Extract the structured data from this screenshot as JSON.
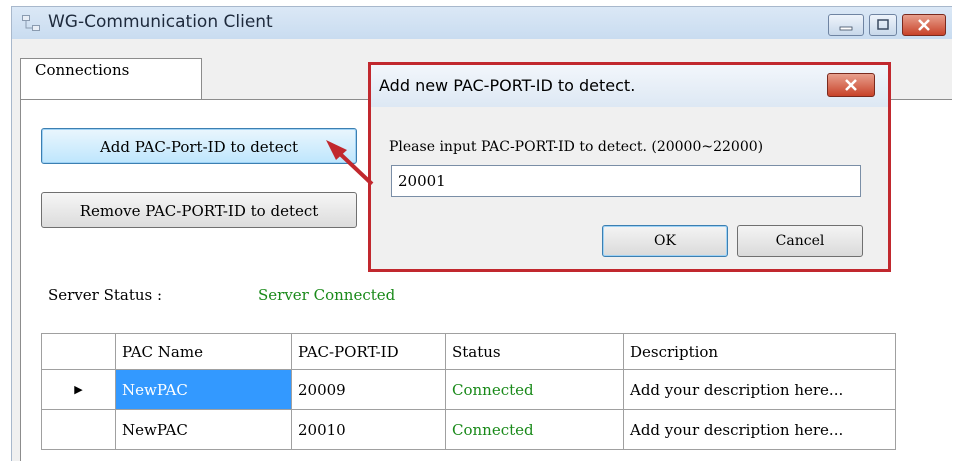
{
  "window": {
    "title": "WG-Communication Client",
    "icon": "network-computers-icon"
  },
  "tabs": [
    {
      "label": "Connections",
      "selected": true
    }
  ],
  "buttons": {
    "add_label": "Add PAC-Port-ID to detect",
    "remove_label": "Remove PAC-PORT-ID to detect"
  },
  "server_status": {
    "label": "Server Status :",
    "value": "Server Connected",
    "color": "#1a8a1a"
  },
  "table": {
    "columns": [
      "PAC Name",
      "PAC-PORT-ID",
      "Status",
      "Description"
    ],
    "rows": [
      {
        "current": true,
        "selected_cell": "name",
        "name": "NewPAC",
        "port": "20009",
        "status": "Connected",
        "description": "Add your description here..."
      },
      {
        "current": false,
        "name": "NewPAC",
        "port": "20010",
        "status": "Connected",
        "description": "Add your description here..."
      }
    ]
  },
  "dialog": {
    "title": "Add new PAC-PORT-ID to detect.",
    "prompt": "Please input PAC-PORT-ID to detect. (20000~22000)",
    "input_value": "20001",
    "ok_label": "OK",
    "cancel_label": "Cancel",
    "highlight_color": "#c1282e"
  },
  "colors": {
    "selection": "#3399ff",
    "annotation_red": "#c1282e"
  }
}
